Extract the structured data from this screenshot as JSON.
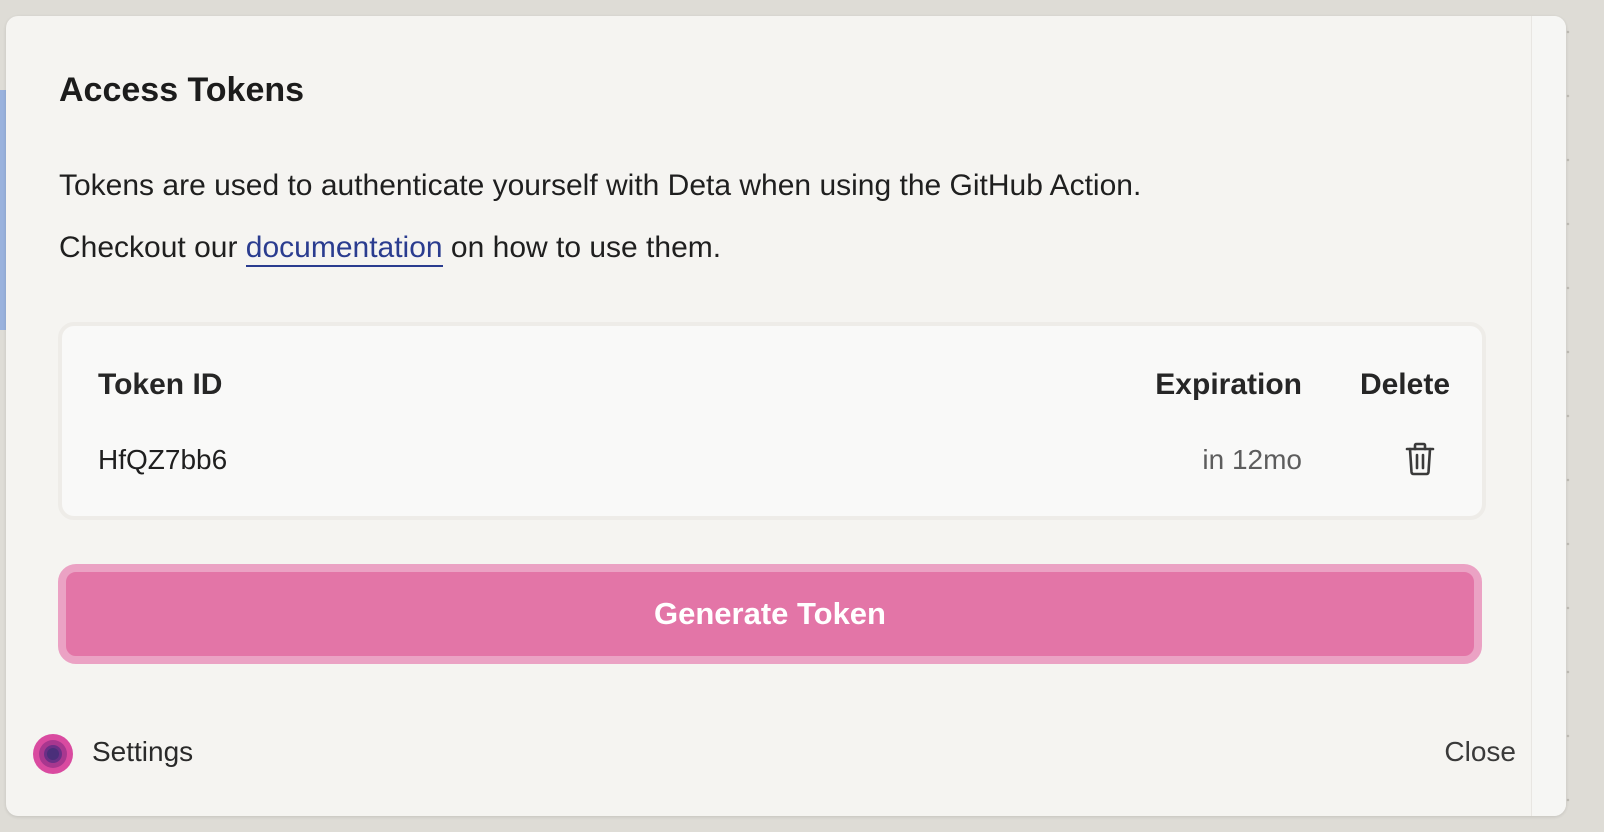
{
  "modal": {
    "title": "Access Tokens",
    "description_line1": "Tokens are used to authenticate yourself with Deta when using the GitHub Action.",
    "description_line2_prefix": "Checkout our ",
    "description_link": "documentation",
    "description_line2_suffix": " on how to use them."
  },
  "tokens_table": {
    "headers": {
      "token_id": "Token ID",
      "expiration": "Expiration",
      "delete": "Delete"
    },
    "rows": [
      {
        "token_id": "HfQZ7bb6",
        "expiration": "in 12mo",
        "delete_icon": "trash-icon"
      }
    ]
  },
  "actions": {
    "generate_label": "Generate Token"
  },
  "footer": {
    "app_label": "Settings",
    "close_label": "Close"
  },
  "colors": {
    "primary_button": "#e375a7",
    "primary_button_border": "#eba2c4",
    "link": "#2a3c8f",
    "logo_outer": "#d94aa0",
    "logo_inner": "#4a2f7a"
  }
}
